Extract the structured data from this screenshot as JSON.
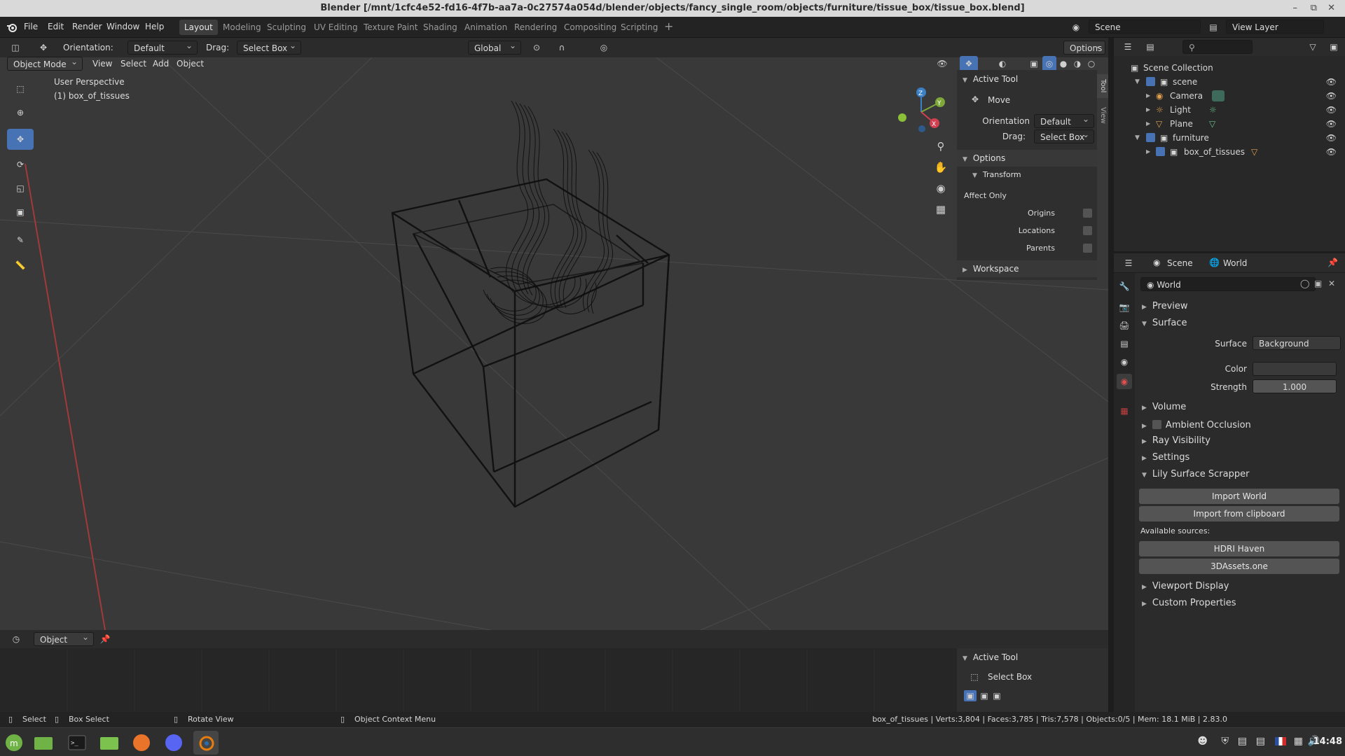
{
  "window": {
    "title": "Blender [/mnt/1cfc4e52-fd16-4f7b-aa7a-0c27574a054d/blender/objects/fancy_single_room/objects/furniture/tissue_box/tissue_box.blend]"
  },
  "menu": [
    "File",
    "Edit",
    "Render",
    "Window",
    "Help"
  ],
  "workspaces": [
    "Layout",
    "Modeling",
    "Sculpting",
    "UV Editing",
    "Texture Paint",
    "Shading",
    "Animation",
    "Rendering",
    "Compositing",
    "Scripting"
  ],
  "topbar": {
    "scene": "Scene",
    "view_layer": "View Layer"
  },
  "tool_header": {
    "orientation_label": "Orientation:",
    "orientation_value": "Default",
    "drag_label": "Drag:",
    "drag_value": "Select Box",
    "transform": "Global",
    "options": "Options"
  },
  "vp_header": {
    "mode": "Object Mode",
    "menus": [
      "View",
      "Select",
      "Add",
      "Object"
    ]
  },
  "viewport": {
    "perspective": "User Perspective",
    "object": "(1) box_of_tissues"
  },
  "npanel": {
    "tabs": [
      "Tool",
      "View"
    ],
    "active_tool": "Active Tool",
    "tool_name": "Move",
    "orientation_label": "Orientation",
    "orientation_value": "Default",
    "drag_label": "Drag:",
    "drag_value": "Select Box",
    "options": "Options",
    "transform": "Transform",
    "affect_only": "Affect Only",
    "origins": "Origins",
    "locations": "Locations",
    "parents": "Parents",
    "workspace": "Workspace"
  },
  "outliner": {
    "root": "Scene Collection",
    "rows": [
      {
        "label": "scene",
        "indent": 1
      },
      {
        "label": "Camera",
        "indent": 2
      },
      {
        "label": "Light",
        "indent": 2
      },
      {
        "label": "Plane",
        "indent": 2
      },
      {
        "label": "furniture",
        "indent": 1
      },
      {
        "label": "box_of_tissues",
        "indent": 2
      }
    ]
  },
  "properties": {
    "breadcrumb_scene": "Scene",
    "breadcrumb_world": "World",
    "world_name": "World",
    "preview": "Preview",
    "surface": "Surface",
    "surface_label": "Surface",
    "surface_value": "Background",
    "color_label": "Color",
    "strength_label": "Strength",
    "strength_value": "1.000",
    "volume": "Volume",
    "ambient_occlusion": "Ambient Occlusion",
    "ray_visibility": "Ray Visibility",
    "settings": "Settings",
    "lily": "Lily Surface Scrapper",
    "import_world": "Import World",
    "import_clipboard": "Import from clipboard",
    "available": "Available sources:",
    "hdri": "HDRI Haven",
    "assets": "3DAssets.one",
    "viewport_display": "Viewport Display",
    "custom_properties": "Custom Properties"
  },
  "timeline": {
    "mode": "Object",
    "active_tool": "Active Tool",
    "tool_name": "Select Box"
  },
  "statusbar": {
    "select": "Select",
    "box_select": "Box Select",
    "rotate": "Rotate View",
    "context": "Object Context Menu",
    "stats": "box_of_tissues | Verts:3,804 | Faces:3,785 | Tris:7,578 | Objects:0/5 | Mem: 18.1 MiB | 2.83.0"
  },
  "taskbar": {
    "time": "14:48"
  },
  "colors": {
    "accent": "#4772b3",
    "viewport": "#393939",
    "panel": "#2b2b2b"
  }
}
